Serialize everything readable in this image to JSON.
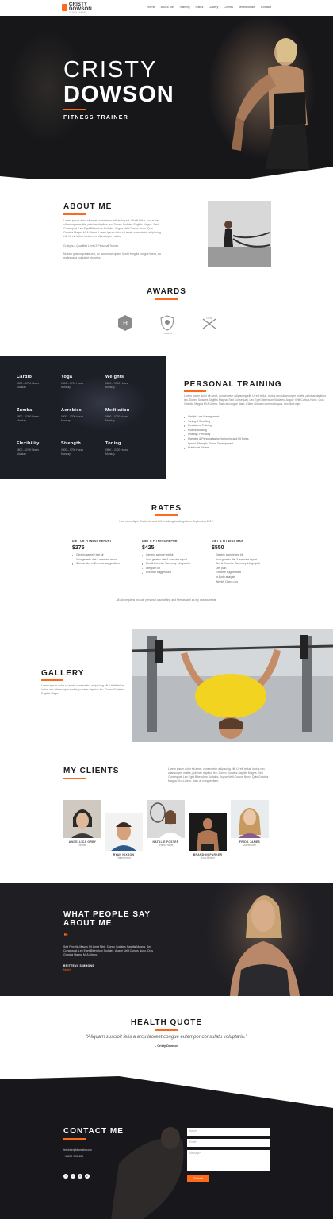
{
  "brand": {
    "line1": "CRISTY",
    "line2": "DOWSON",
    "tagline": "FITNESS TRAINER",
    "accent": "#ff6a1a"
  },
  "nav": {
    "items": [
      "Home",
      "About Me",
      "Training",
      "Rates",
      "Gallery",
      "Clients",
      "Testimonials",
      "Contact"
    ]
  },
  "hero": {
    "first_name": "CRISTY",
    "last_name": "DOWSON",
    "role": "FITNESS TRAINER"
  },
  "about": {
    "title": "ABOUT ME",
    "p1": "Lorem ipsum dolor sit amet consectetur adipiscing elit. Ut elit tellus, luctus nec ullamcorper mattis, pulvinar dapibus leo. Donec Sodales Sagittis Magna. Sed Consequat, Leo Eget Bibendum Sodales, Augue Velit Cursus Nunc. Quis Gravida Magna Mi A Libero. Lorem ipsum dolor sit amet, consectetur adipiscing elit. Ut elit tellus, luctus nec ullamcorper mattis.",
    "p2": "Cristy is a Qualified Level 3 Personal Trainer.",
    "p3": "Nullam quis vulputate orci, ac accumsan quam. Morbi fringilla congue libero, eu malesuada vulputate pharetra."
  },
  "awards": {
    "title": "AWARDS",
    "items": [
      {
        "icon": "hexagon-emblem-icon"
      },
      {
        "icon": "shield-fitness-icon",
        "label": "FITNESS"
      },
      {
        "icon": "gym-crossed-icon",
        "label": "GYM"
      }
    ]
  },
  "classes": [
    {
      "name": "Cardio",
      "time": "0800 – 0700 Hours",
      "day": "Monday"
    },
    {
      "name": "Yoga",
      "time": "0800 – 0700 Hours",
      "day": "Monday"
    },
    {
      "name": "Weights",
      "time": "0800 – 0700 Hours",
      "day": "Monday"
    },
    {
      "name": "Zumba",
      "time": "0800 – 0700 Hours",
      "day": "Monday"
    },
    {
      "name": "Aerobics",
      "time": "0800 – 0700 Hours",
      "day": "Monday"
    },
    {
      "name": "Meditation",
      "time": "0800 – 0700 Hours",
      "day": "Monday"
    },
    {
      "name": "Flexibility",
      "time": "0800 – 0700 Hours",
      "day": "Monday"
    },
    {
      "name": "Strength",
      "time": "0800 – 0700 Hours",
      "day": "Monday"
    },
    {
      "name": "Toning",
      "time": "0800 – 0700 Hours",
      "day": "Monday"
    }
  ],
  "training": {
    "title": "PERSONAL TRAINING",
    "text": "Lorem ipsum dolor sit amet, consectetur adipiscing elit. Ut elit tellus, luctus nec ullamcorper mattis, pulvinar dapibus leo. Donec Sodales Sagittis Magna. Sed Consequat, Leo Eget Bibendum Sodales, Augue Velit Cursus Nunc. Quis Gravida Magna Mi A Libero. Nam at congue diam. Etiam aliquam commodo quis, tincidunt eget.",
    "items": [
      "Weight Loss Management",
      "Toning & Sculpting",
      "Resistance Training",
      "Muscle Building",
      "Mobility / Flexibility",
      "Planning & Personalisation for toning and Fit Rules",
      "Speed, Strength, Power Development",
      "Nutritional Advice"
    ]
  },
  "rates": {
    "title": "RATES",
    "intro": "I am currently in California and will be taking bookings from September 2017.",
    "plans": [
      {
        "name": "DIET OR FITNESS REPORT",
        "price": "$275",
        "features": [
          "Generic sample text kit",
          "Your generic diet & exercise report",
          "Sample diet or Exercise suggestions"
        ]
      },
      {
        "name": "DIET & FITNESS REPORT",
        "price": "$425",
        "features": [
          "Generic sample text kit",
          "Your generic diet & exercise report",
          "Diet & Exercise Summary Infographic",
          "Diet plan kit",
          "Exercise suggestions"
        ]
      },
      {
        "name": "DIET & FITNESS MAX",
        "price": "$550",
        "features": [
          "Generic sample text kit",
          "Your generic diet & exercise report",
          "Diet & Exercise Summary Infographic",
          "Diet plan",
          "Exercise suggestions",
          "In-Body analysis",
          "Weekly Check ups"
        ]
      }
    ],
    "footnote": "All above plans include personal counselling and free as well as my assessments."
  },
  "gallery": {
    "title": "GALLERY",
    "text": "Lorem ipsum dolor sit amet, consectetur adipiscing elit. Ut elit tellus, luctus nec ullamcorper mattis, pulvinar dapibus leo. Donec Sodales Sagittis Magna."
  },
  "clients": {
    "title": "MY CLIENTS",
    "text": "Lorem ipsum dolor sit amet, consectetur adipiscing elit. Ut elit tellus, luctus nec ullamcorper mattis, pulvinar dapibus leo. Donec Sodales Sagittis Magna. Sed Consequat, Leo Eget Bibendum Sodales, Augue Velit Cursus Nunc. Quis Gravida Magna Mi A Libero. Nam at congue diam.",
    "people": [
      {
        "name": "ANGELLICA GREY",
        "role": "Model"
      },
      {
        "name": "RYAN NIXSON",
        "role": "Entrepreneur"
      },
      {
        "name": "NATALIE FOSTER",
        "role": "Tennis Player"
      },
      {
        "name": "BRANDON PARKER",
        "role": "Body Builder"
      },
      {
        "name": "FRIDA JAMES",
        "role": "Adventurer"
      }
    ]
  },
  "testimonial": {
    "title_l1": "WHAT PEOPLE SAY",
    "title_l2": "ABOUT ME",
    "quote_mark": "❝",
    "text": "Sed Fringilla Mauris Sit Amet Nibh. Donec Sodales Sagittis Magna. Sed Consequat, Leo Eget Bibendum Sodales, Augue Velit Cursus Nunc, Quis Gravida Magna Mi A Libero.",
    "author": "BRITTENY SIMMONS",
    "author_role": "Model"
  },
  "health_quote": {
    "title": "HEALTH QUOTE",
    "quote": "“Aliquam suscipit felis a arcu laoreet congue eutempor consulatu voluptaria.”",
    "author": "– Cristy Dowson"
  },
  "contact": {
    "title": "CONTACT ME",
    "email": "letstrain@domain.com",
    "phone": "+1 800 123 456",
    "social_icons": [
      "facebook-icon",
      "twitter-icon",
      "instagram-icon",
      "linkedin-icon"
    ],
    "fields": {
      "name_ph": "Name*",
      "email_ph": "Email*",
      "message_ph": "Message*"
    },
    "submit": "Submit"
  }
}
